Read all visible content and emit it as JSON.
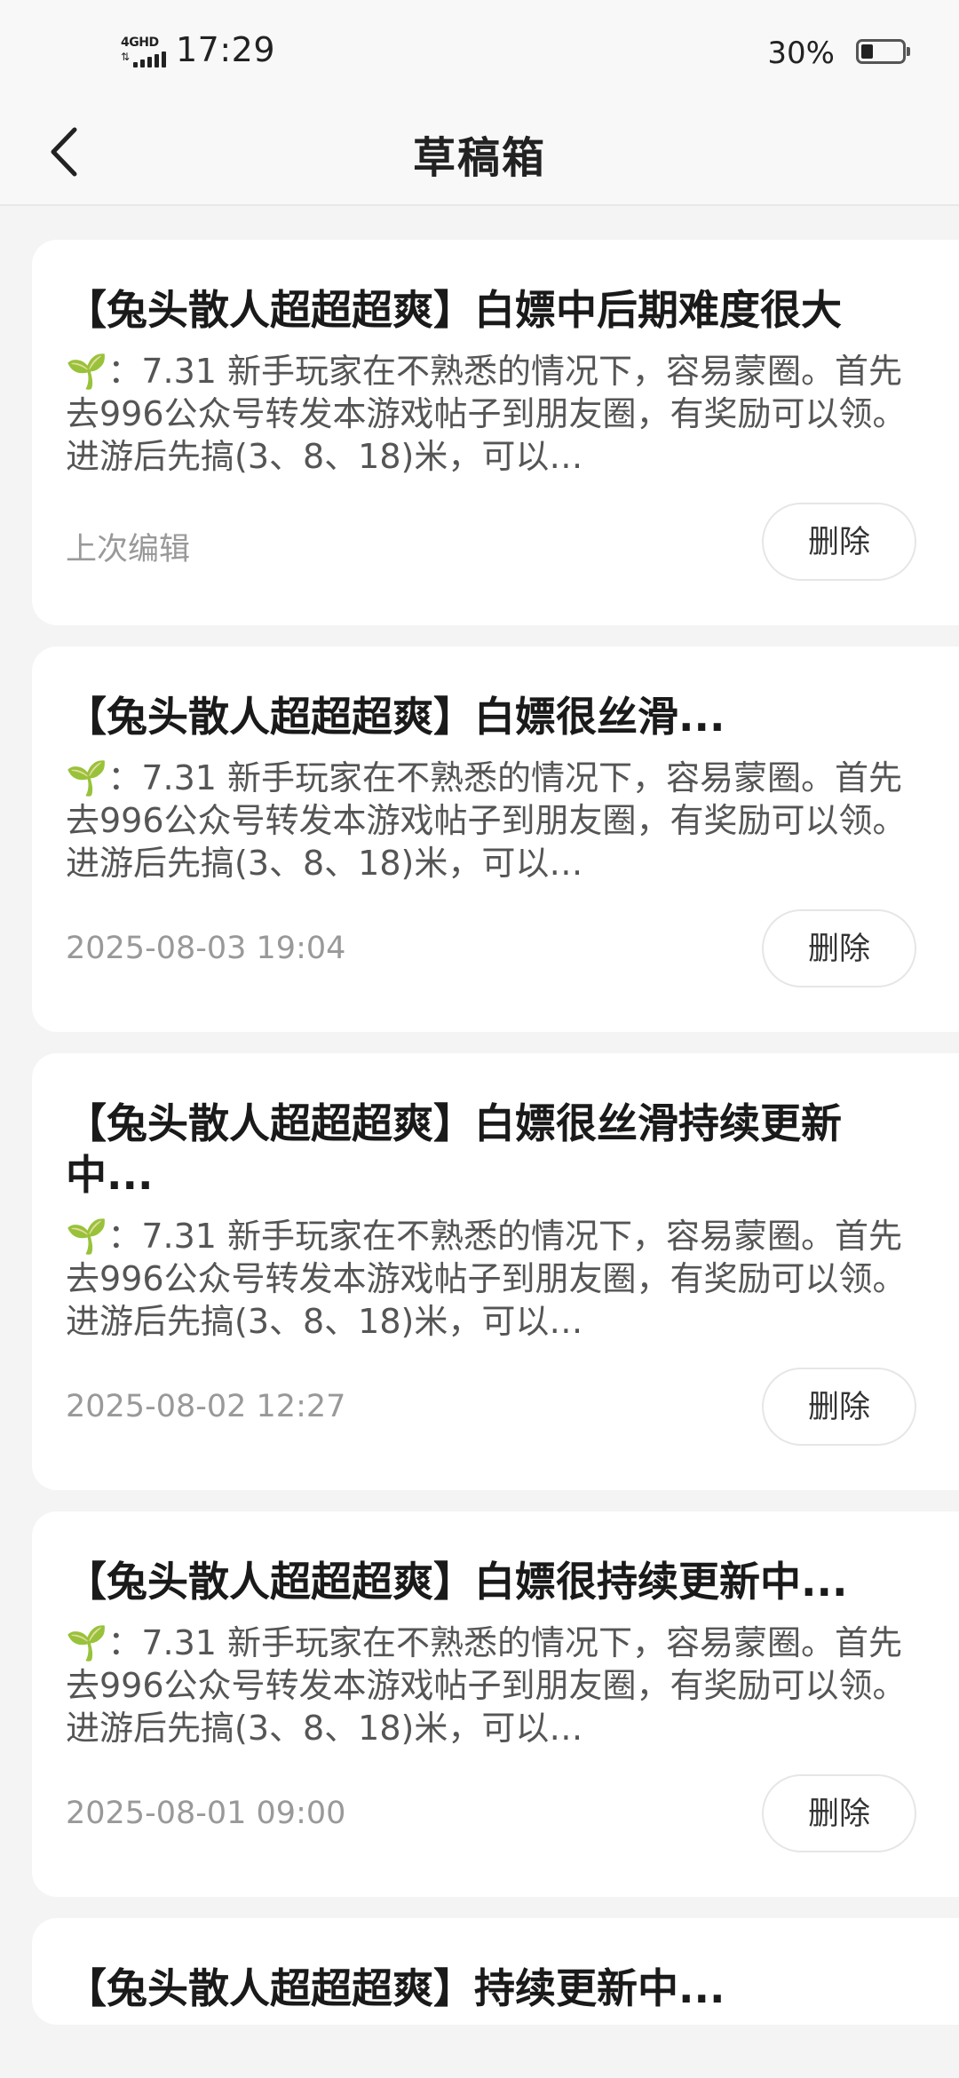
{
  "status_bar": {
    "network": "4GHD",
    "time": "17:29",
    "battery_percent": "30%",
    "battery_level": 0.3
  },
  "header": {
    "back_icon": "chevron-left-icon",
    "title": "草稿箱"
  },
  "drafts": [
    {
      "title": "【兔头散人超超超爽】白嫖中后期难度很大",
      "excerpt_icon": "🌱",
      "excerpt": "：7.31 新手玩家在不熟悉的情况下，容易蒙圈。首先去996公众号转发本游戏帖子到朋友圈，有奖励可以领。进游后先搞(3、8、18)米，可以…",
      "meta": "上次编辑",
      "delete_label": "删除"
    },
    {
      "title": "【兔头散人超超超爽】白嫖很丝滑...",
      "excerpt_icon": "🌱",
      "excerpt": "：7.31 新手玩家在不熟悉的情况下，容易蒙圈。首先去996公众号转发本游戏帖子到朋友圈，有奖励可以领。进游后先搞(3、8、18)米，可以…",
      "meta": "2025-08-03 19:04",
      "delete_label": "删除"
    },
    {
      "title": "【兔头散人超超超爽】白嫖很丝滑持续更新中...",
      "excerpt_icon": "🌱",
      "excerpt": "：7.31 新手玩家在不熟悉的情况下，容易蒙圈。首先去996公众号转发本游戏帖子到朋友圈，有奖励可以领。进游后先搞(3、8、18)米，可以…",
      "meta": "2025-08-02 12:27",
      "delete_label": "删除"
    },
    {
      "title": "【兔头散人超超超爽】白嫖很持续更新中...",
      "excerpt_icon": "🌱",
      "excerpt": "：7.31 新手玩家在不熟悉的情况下，容易蒙圈。首先去996公众号转发本游戏帖子到朋友圈，有奖励可以领。进游后先搞(3、8、18)米，可以…",
      "meta": "2025-08-01 09:00",
      "delete_label": "删除"
    },
    {
      "title": "【兔头散人超超超爽】持续更新中..."
    }
  ]
}
